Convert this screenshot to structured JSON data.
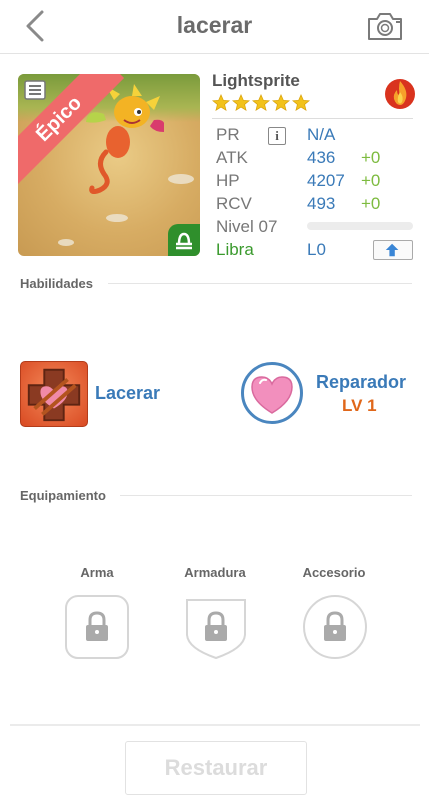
{
  "header": {
    "title": "lacerar"
  },
  "card": {
    "rarity": "Épico",
    "sign_icon": "libra-icon"
  },
  "monster": {
    "name": "Lightsprite",
    "stars": 5,
    "element_icon": "fire-icon",
    "stats": [
      {
        "label": "PR",
        "value": "N/A",
        "bonus": ""
      },
      {
        "label": "ATK",
        "value": "436",
        "bonus": "+0"
      },
      {
        "label": "HP",
        "value": "4207",
        "bonus": "+0"
      },
      {
        "label": "RCV",
        "value": "493",
        "bonus": "+0"
      }
    ],
    "level_label": "Nivel 07",
    "xp_progress": 0,
    "sign_name": "Libra",
    "rank": "L0"
  },
  "skills": {
    "section_title": "Habilidades",
    "active": {
      "name": "Lacerar"
    },
    "passive": {
      "name": "Reparador",
      "level": "LV 1"
    }
  },
  "equipment": {
    "section_title": "Equipamiento",
    "slots": [
      {
        "label": "Arma"
      },
      {
        "label": "Armadura"
      },
      {
        "label": "Accesorio"
      }
    ]
  },
  "actions": {
    "restore_label": "Restaurar"
  },
  "colors": {
    "accent": "#3a7ab8",
    "bonus": "#7dbb3f",
    "ribbon": "#ef6a6a",
    "level": "#e0671a"
  }
}
